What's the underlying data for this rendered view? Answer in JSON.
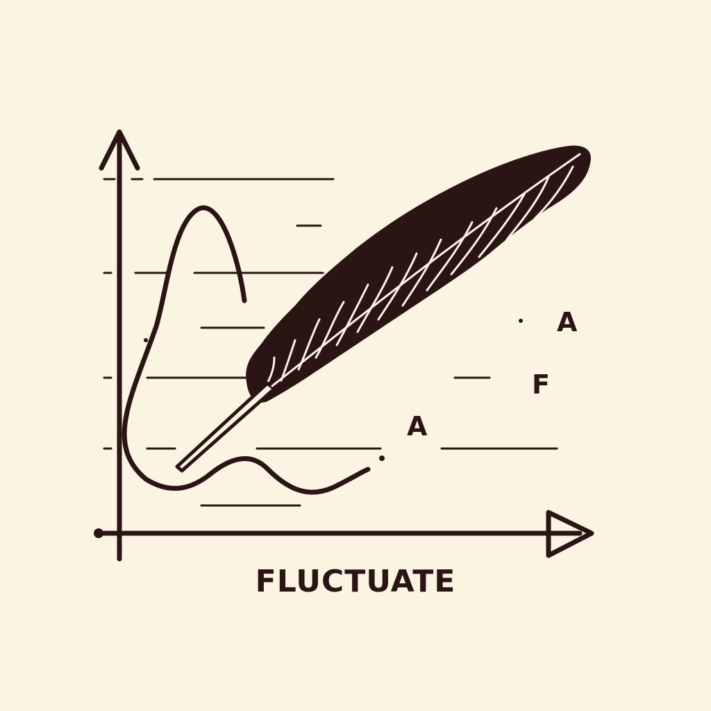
{
  "caption": "FLUCTUATE",
  "scattered_letters": [
    "A",
    "F",
    "A"
  ],
  "colors": {
    "background": "#fbf4e3",
    "ink": "#2a1414"
  }
}
